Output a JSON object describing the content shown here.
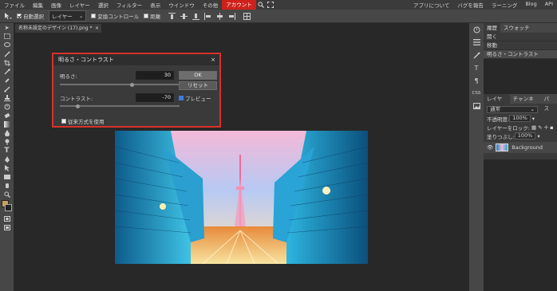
{
  "menubar": {
    "items": [
      "ファイル",
      "編集",
      "画像",
      "レイヤー",
      "選択",
      "フィルター",
      "表示",
      "ウインドウ",
      "その他"
    ],
    "account": "アカウント",
    "right": [
      "アプリについて",
      "バグを報告",
      "ラーニング",
      "Blog",
      "API"
    ],
    "accent_color": "#d0201a"
  },
  "toolbar": {
    "auto_select": "自動選択",
    "layer_select": "レイヤー",
    "transform_controls": "変換コントロール",
    "distance": "距離"
  },
  "tab": {
    "title": "名称未設定のデザイン (17).png *",
    "close": "×"
  },
  "dialog": {
    "title": "明るさ・コントラスト",
    "close": "×",
    "brightness_label": "明るさ:",
    "brightness_value": "30",
    "brightness_level": 0.6,
    "contrast_label": "コントラスト:",
    "contrast_value": "-70",
    "contrast_level": 0.15,
    "ok": "OK",
    "reset": "リセット",
    "preview": "プレビュー",
    "legacy": "従来方式を使用",
    "border_color": "#d9312a"
  },
  "right_strip": {
    "css": "CSS"
  },
  "history_panel": {
    "tabs": [
      "履歴",
      "スウォッチ"
    ],
    "items": [
      "開く",
      "移動",
      "明るさ・コントラスト"
    ]
  },
  "layers_panel": {
    "tabs": [
      "レイヤー",
      "チャンネル",
      "パス"
    ],
    "blend_mode": "通常",
    "opacity_label": "不透明度:",
    "opacity_value": "100%",
    "lock_label": "レイヤーをロック:",
    "fill_label": "塗りつぶし:",
    "fill_value": "100%",
    "layer_name": "Background"
  },
  "icons": [
    "move-icon",
    "marquee-icon",
    "lasso-icon",
    "magic-wand-icon",
    "crop-icon",
    "eyedropper-icon",
    "healing-icon",
    "brush-icon",
    "stamp-icon",
    "history-brush-icon",
    "eraser-icon",
    "fill-icon",
    "blur-icon",
    "dodge-icon",
    "pen-icon",
    "type-icon",
    "path-select-icon",
    "shape-icon",
    "hand-icon",
    "zoom-icon",
    "search-icon",
    "fullscreen-icon",
    "eye-icon",
    "link-icon"
  ]
}
